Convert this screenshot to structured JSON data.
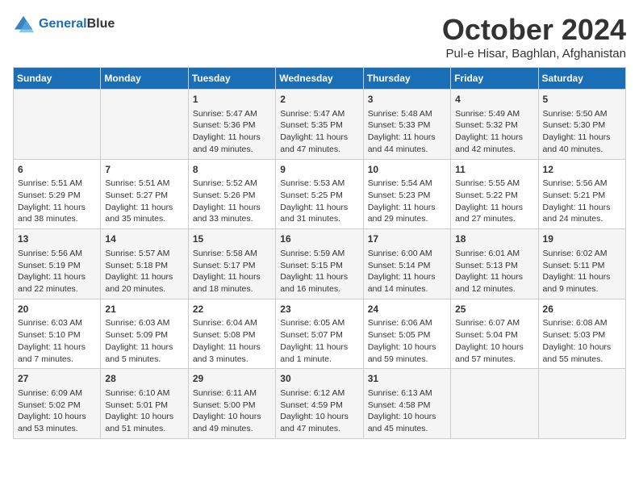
{
  "header": {
    "logo_line1": "General",
    "logo_line2": "Blue",
    "month": "October 2024",
    "location": "Pul-e Hisar, Baghlan, Afghanistan"
  },
  "days_of_week": [
    "Sunday",
    "Monday",
    "Tuesday",
    "Wednesday",
    "Thursday",
    "Friday",
    "Saturday"
  ],
  "weeks": [
    [
      {
        "day": "",
        "content": ""
      },
      {
        "day": "",
        "content": ""
      },
      {
        "day": "1",
        "content": "Sunrise: 5:47 AM\nSunset: 5:36 PM\nDaylight: 11 hours and 49 minutes."
      },
      {
        "day": "2",
        "content": "Sunrise: 5:47 AM\nSunset: 5:35 PM\nDaylight: 11 hours and 47 minutes."
      },
      {
        "day": "3",
        "content": "Sunrise: 5:48 AM\nSunset: 5:33 PM\nDaylight: 11 hours and 44 minutes."
      },
      {
        "day": "4",
        "content": "Sunrise: 5:49 AM\nSunset: 5:32 PM\nDaylight: 11 hours and 42 minutes."
      },
      {
        "day": "5",
        "content": "Sunrise: 5:50 AM\nSunset: 5:30 PM\nDaylight: 11 hours and 40 minutes."
      }
    ],
    [
      {
        "day": "6",
        "content": "Sunrise: 5:51 AM\nSunset: 5:29 PM\nDaylight: 11 hours and 38 minutes."
      },
      {
        "day": "7",
        "content": "Sunrise: 5:51 AM\nSunset: 5:27 PM\nDaylight: 11 hours and 35 minutes."
      },
      {
        "day": "8",
        "content": "Sunrise: 5:52 AM\nSunset: 5:26 PM\nDaylight: 11 hours and 33 minutes."
      },
      {
        "day": "9",
        "content": "Sunrise: 5:53 AM\nSunset: 5:25 PM\nDaylight: 11 hours and 31 minutes."
      },
      {
        "day": "10",
        "content": "Sunrise: 5:54 AM\nSunset: 5:23 PM\nDaylight: 11 hours and 29 minutes."
      },
      {
        "day": "11",
        "content": "Sunrise: 5:55 AM\nSunset: 5:22 PM\nDaylight: 11 hours and 27 minutes."
      },
      {
        "day": "12",
        "content": "Sunrise: 5:56 AM\nSunset: 5:21 PM\nDaylight: 11 hours and 24 minutes."
      }
    ],
    [
      {
        "day": "13",
        "content": "Sunrise: 5:56 AM\nSunset: 5:19 PM\nDaylight: 11 hours and 22 minutes."
      },
      {
        "day": "14",
        "content": "Sunrise: 5:57 AM\nSunset: 5:18 PM\nDaylight: 11 hours and 20 minutes."
      },
      {
        "day": "15",
        "content": "Sunrise: 5:58 AM\nSunset: 5:17 PM\nDaylight: 11 hours and 18 minutes."
      },
      {
        "day": "16",
        "content": "Sunrise: 5:59 AM\nSunset: 5:15 PM\nDaylight: 11 hours and 16 minutes."
      },
      {
        "day": "17",
        "content": "Sunrise: 6:00 AM\nSunset: 5:14 PM\nDaylight: 11 hours and 14 minutes."
      },
      {
        "day": "18",
        "content": "Sunrise: 6:01 AM\nSunset: 5:13 PM\nDaylight: 11 hours and 12 minutes."
      },
      {
        "day": "19",
        "content": "Sunrise: 6:02 AM\nSunset: 5:11 PM\nDaylight: 11 hours and 9 minutes."
      }
    ],
    [
      {
        "day": "20",
        "content": "Sunrise: 6:03 AM\nSunset: 5:10 PM\nDaylight: 11 hours and 7 minutes."
      },
      {
        "day": "21",
        "content": "Sunrise: 6:03 AM\nSunset: 5:09 PM\nDaylight: 11 hours and 5 minutes."
      },
      {
        "day": "22",
        "content": "Sunrise: 6:04 AM\nSunset: 5:08 PM\nDaylight: 11 hours and 3 minutes."
      },
      {
        "day": "23",
        "content": "Sunrise: 6:05 AM\nSunset: 5:07 PM\nDaylight: 11 hours and 1 minute."
      },
      {
        "day": "24",
        "content": "Sunrise: 6:06 AM\nSunset: 5:05 PM\nDaylight: 10 hours and 59 minutes."
      },
      {
        "day": "25",
        "content": "Sunrise: 6:07 AM\nSunset: 5:04 PM\nDaylight: 10 hours and 57 minutes."
      },
      {
        "day": "26",
        "content": "Sunrise: 6:08 AM\nSunset: 5:03 PM\nDaylight: 10 hours and 55 minutes."
      }
    ],
    [
      {
        "day": "27",
        "content": "Sunrise: 6:09 AM\nSunset: 5:02 PM\nDaylight: 10 hours and 53 minutes."
      },
      {
        "day": "28",
        "content": "Sunrise: 6:10 AM\nSunset: 5:01 PM\nDaylight: 10 hours and 51 minutes."
      },
      {
        "day": "29",
        "content": "Sunrise: 6:11 AM\nSunset: 5:00 PM\nDaylight: 10 hours and 49 minutes."
      },
      {
        "day": "30",
        "content": "Sunrise: 6:12 AM\nSunset: 4:59 PM\nDaylight: 10 hours and 47 minutes."
      },
      {
        "day": "31",
        "content": "Sunrise: 6:13 AM\nSunset: 4:58 PM\nDaylight: 10 hours and 45 minutes."
      },
      {
        "day": "",
        "content": ""
      },
      {
        "day": "",
        "content": ""
      }
    ]
  ]
}
